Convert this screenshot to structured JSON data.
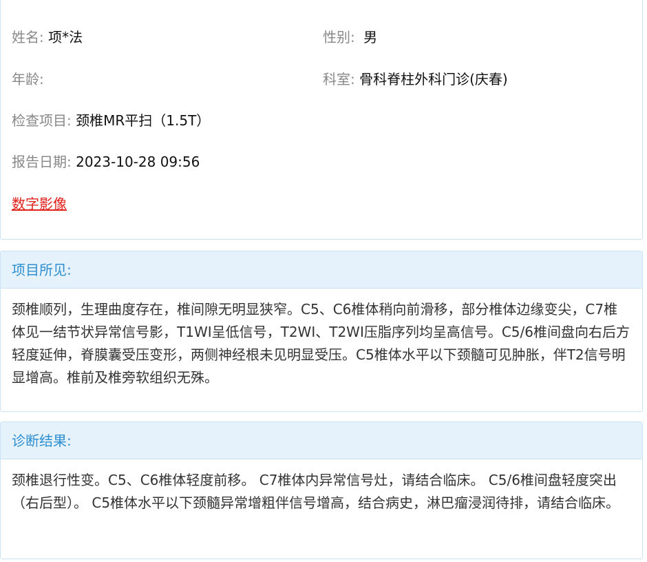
{
  "patient": {
    "name_label": "姓名:",
    "name_value": "项*法",
    "gender_label": "性别:",
    "gender_value": "男",
    "age_label": "年龄:",
    "age_value": "",
    "dept_label": "科室:",
    "dept_value": "骨科脊柱外科门诊(庆春)",
    "exam_label": "检查项目:",
    "exam_value": "颈椎MR平扫（1.5T）",
    "date_label": "报告日期:",
    "date_value": "2023-10-28 09:56",
    "image_link": "数字影像"
  },
  "findings": {
    "title": "项目所见:",
    "text": "颈椎顺列，生理曲度存在，椎间隙无明显狭窄。C5、C6椎体稍向前滑移，部分椎体边缘变尖，C7椎体见一结节状异常信号影，T1WI呈低信号，T2WI、T2WI压脂序列均呈高信号。C5/6椎间盘向右后方轻度延伸，脊膜囊受压变形，两侧神经根未见明显受压。C5椎体水平以下颈髓可见肿胀，伴T2信号明显增高。椎前及椎旁软组织无殊。"
  },
  "diagnosis": {
    "title": "诊断结果:",
    "text": "颈椎退行性变。C5、C6椎体轻度前移。 C7椎体内异常信号灶，请结合临床。 C5/6椎间盘轻度突出（右后型）。 C5椎体水平以下颈髓异常增粗伴信号增高，结合病史，淋巴瘤浸润待排，请结合临床。"
  },
  "colors": {
    "accent": "#2e8fd0",
    "header_bg": "#e5f2fc",
    "border": "#c9e3f5",
    "link": "#e0201b"
  }
}
